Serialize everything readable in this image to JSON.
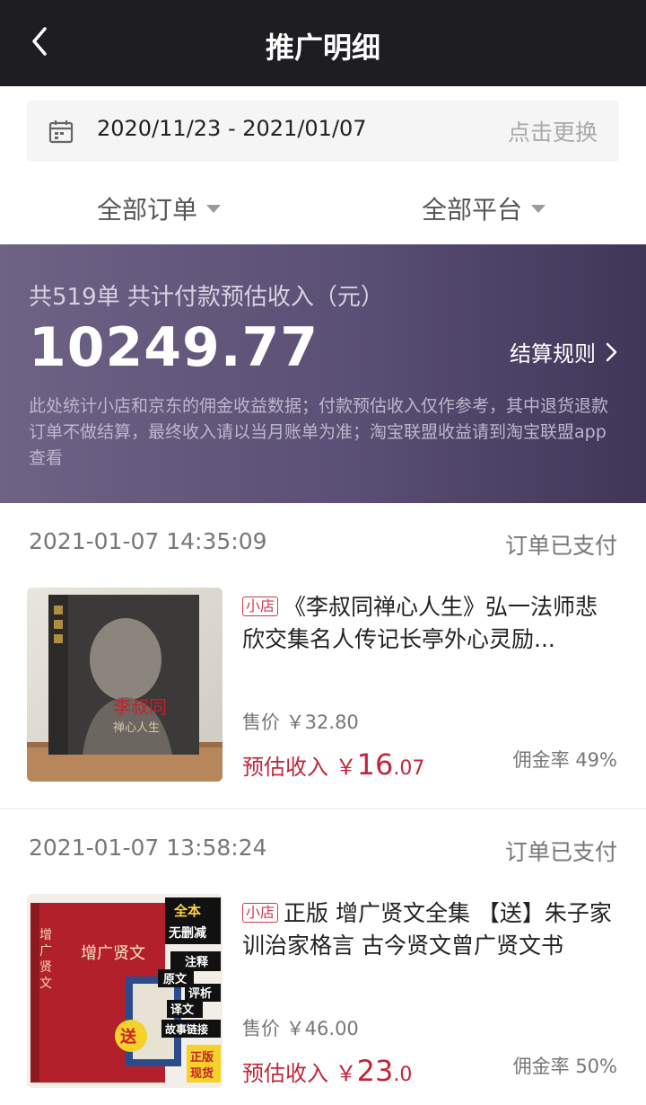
{
  "nav": {
    "title": "推广明细"
  },
  "filter": {
    "date_range": "2020/11/23 - 2021/01/07",
    "change_label": "点击更换",
    "orders_label": "全部订单",
    "platforms_label": "全部平台"
  },
  "summary": {
    "caption": "共519单 共计付款预估收入（元）",
    "amount": "10249.77",
    "rules_label": "结算规则",
    "note": "此处统计小店和京东的佣金收益数据；付款预估收入仅作参考，其中退货退款订单不做结算，最终收入请以当月账单为准；淘宝联盟收益请到淘宝联盟app查看"
  },
  "orders": [
    {
      "time": "2021-01-07 14:35:09",
      "status": "订单已支付",
      "badge": "小店",
      "title": "《李叔同禅心人生》弘一法师悲欣交集名人传记长亭外心灵励...",
      "price": "售价 ￥32.80",
      "income_label": "预估收入",
      "income_currency": "￥",
      "income_int": "16",
      "income_dec": ".07",
      "rate": "佣金率 49%",
      "cover_text_1": "李叔同",
      "cover_text_2": "禅心人生"
    },
    {
      "time": "2021-01-07 13:58:24",
      "status": "订单已支付",
      "badge": "小店",
      "title": "正版 增广贤文全集 【送】朱子家训治家格言 古今贤文曾广贤文书",
      "price": "售价 ￥46.00",
      "income_label": "预估收入",
      "income_currency": "￥",
      "income_int": "23",
      "income_dec": ".0",
      "rate": "佣金率 50%",
      "cover_text_1": "增广贤文",
      "cover_text_2": "全本",
      "cover_text_3": "无删减",
      "cover_text_4": "原文",
      "cover_text_5": "注释",
      "cover_text_6": "译文",
      "cover_text_7": "评析",
      "cover_text_8": "故事链接",
      "cover_text_9": "送",
      "cover_text_10": "正版",
      "cover_text_11": "现货"
    }
  ]
}
